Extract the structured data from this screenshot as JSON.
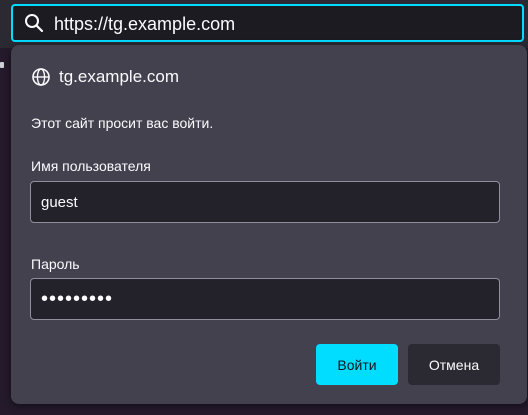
{
  "urlbar": {
    "url": "https://tg.example.com",
    "icon": "search-icon"
  },
  "auth_dialog": {
    "host_icon": "globe-icon",
    "host": "tg.example.com",
    "message": "Этот сайт просит вас войти.",
    "username_label": "Имя пользователя",
    "username_value": "guest",
    "password_label": "Пароль",
    "password_value": "•••••••••",
    "login_button": "Войти",
    "cancel_button": "Отмена"
  },
  "colors": {
    "accent": "#00ddff",
    "panel_bg": "#42414d",
    "field_bg": "#23222b",
    "toolbar_bg": "#2b2a33"
  }
}
